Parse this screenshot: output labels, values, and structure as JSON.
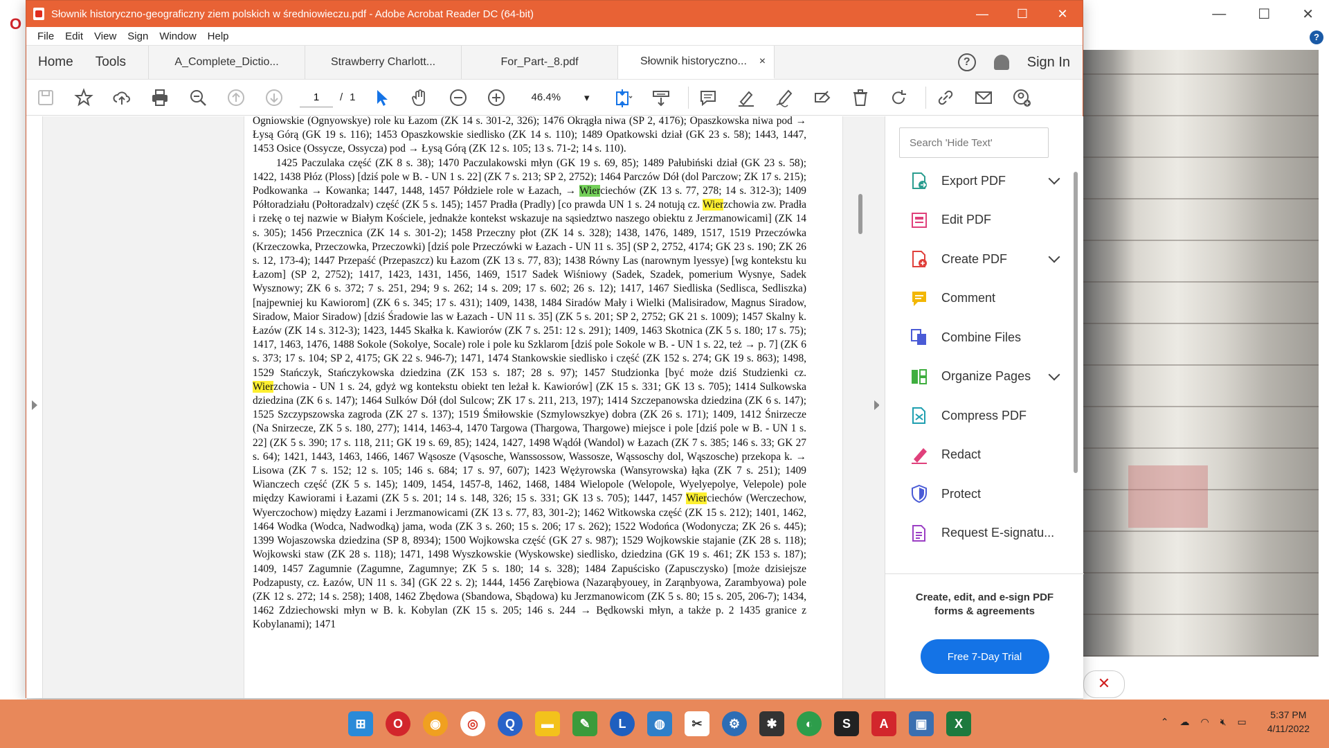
{
  "window": {
    "title": "Słownik historyczno-geograficzny ziem polskich w średniowieczu.pdf - Adobe Acrobat Reader DC (64-bit)",
    "minimize": "—",
    "maximize": "☐",
    "close": "✕"
  },
  "menu": [
    "File",
    "Edit",
    "View",
    "Sign",
    "Window",
    "Help"
  ],
  "tabs": {
    "home": "Home",
    "tools": "Tools",
    "docs": [
      {
        "label": "A_Complete_Dictio..."
      },
      {
        "label": "Strawberry Charlott..."
      },
      {
        "label": "For_Part-_8.pdf"
      },
      {
        "label": "Słownik historyczno..."
      }
    ],
    "close_tab": "×",
    "sign_in": "Sign In",
    "help_glyph": "?"
  },
  "toolbar": {
    "page_current": "1",
    "page_sep": "/",
    "page_total": "1",
    "zoom": "46.4%"
  },
  "document": {
    "p1": "Ogniowskie (Ognyowskye) role ku Łazom (ZK 14 s. 301-2, 326); 1476 Okrągła niwa (SP 2, 4176); Opaszkowska niwa pod → Łysą Górą (GK 19 s. 116); 1453 Opaszkowskie siedlisko (ZK 14 s. 110); 1489 Opatkowski dział (GK 23 s. 58); 1443, 1447, 1453 Osice (Ossycze, Ossycza) pod → Łysą Górą (ZK 12 s. 105; 13 s. 71-2; 14 s. 110).",
    "p2a": "1425 Paczulaka część (ZK 8 s. 38); 1470 Paczulakowski młyn (GK 19 s. 69, 85); 1489 Pałubiński dział (GK 23 s. 58); 1422, 1438 Płóz (Ploss) [dziś pole w B. - UN 1 s. 22] (ZK 7 s. 213; SP 2, 2752); 1464 Parczów Dół (dol Parczow; ZK 17 s. 215); Podkowanka → Kowanka; 1447, 1448, 1457 Półdziele role w Łazach, → ",
    "hl1": "Wier",
    "p2b": "ciechów (ZK 13 s. 77, 278; 14 s. 312-3); 1409 Półtoradziału (Połtoradzalv) część (ZK 5 s. 145); 1457 Pradła (Pradly) [co prawda UN 1 s. 24 notują cz. ",
    "hl2": "Wier",
    "p2c": "zchowia zw. Pradła i rzekę o tej nazwie w Białym Kościele, jednakże kontekst wskazuje na sąsiedztwo naszego obiektu z Jerzmanowicami] (ZK 14 s. 305); 1456 Przecznica (ZK 14 s. 301-2); 1458 Przeczny płot (ZK 14 s. 328); 1438, 1476, 1489, 1517, 1519 Przeczówka (Krzeczowka, Przeczowka, Przeczowki) [dziś pole Przeczówki w Łazach - UN 11 s. 35] (SP 2, 2752, 4174; GK 23 s. 190; ZK 26 s. 12, 173-4); 1447 Przepaść (Przepaszcz) ku Łazom (ZK 13 s. 77, 83); 1438 Równy Las (narownym lyessye) [wg kontekstu ku Łazom] (SP 2, 2752); 1417, 1423, 1431, 1456, 1469, 1517 Sadek Wiśniowy (Sadek, Szadek, pomerium Wysnye, Sadek Wysznowy; ZK 6 s. 372; 7 s. 251, 294; 9 s. 262; 14 s. 209; 17 s. 602; 26 s. 12); 1417, 1467 Siedliska (Sedlisca, Sedliszka) [najpewniej ku Kawiorom] (ZK 6 s. 345; 17 s. 431); 1409, 1438, 1484 Siradów Mały i Wielki (Malisiradow, Magnus Siradow, Siradow, Maior Siradow) [dziś Śradowie las w Łazach - UN 11 s. 35] (ZK 5 s. 201; SP 2, 2752; GK 21 s. 1009); 1457 Skalny k. Łazów (ZK 14 s. 312-3); 1423, 1445 Skałka k. Kawiorów (ZK 7 s. 251: 12 s. 291); 1409, 1463 Skotnica (ZK 5 s. 180; 17 s. 75); 1417, 1463, 1476, 1488 Sokole (Sokolye, Socale) role i pole ku Szklarom [dziś pole Sokole w B. - UN 1 s. 22, też → p. 7] (ZK 6 s. 373; 17 s. 104; SP 2, 4175; GK 22 s. 946-7); 1471, 1474 Stankowskie siedlisko i część (ZK 152 s. 274; GK 19 s. 863); 1498, 1529 Stańczyk, Stańczykowska dziedzina (ZK 153 s. 187; 28 s. 97); 1457 Studzionka [być może dziś Studzienki cz. ",
    "hl3": "Wier",
    "p2d": "zchowia - UN 1 s. 24, gdyż wg kontekstu obiekt ten leżał k. Kawiorów] (ZK 15 s. 331; GK 13 s. 705); 1414 Sulkowska dziedzina (ZK 6 s. 147); 1464 Sulków Dół (dol Sulcow; ZK 17 s. 211, 213, 197); 1414 Szczepanowska dziedzina (ZK 6 s. 147); 1525 Szczypszowska zagroda (ZK 27 s. 137); 1519 Śmiłowskie (Szmylowszkye) dobra (ZK 26 s. 171); 1409, 1412 Śnirzecze (Na Snirzecze, ZK 5 s. 180, 277); 1414, 1463-4, 1470 Targowa (Thargowa, Thargowe) miejsce i pole [dziś pole w B. - UN 1 s. 22] (ZK 5 s. 390; 17 s. 118, 211; GK 19 s. 69, 85); 1424, 1427, 1498 Wądół (Wandol) w Łazach (ZK 7 s. 385; 146 s. 33; GK 27 s. 64); 1421, 1443, 1463, 1466, 1467 Wąsosze (Vąsosche, Wanssossow, Wassosze, Wąssoschy dol, Wąszosche) przekopa k. → Lisowa (ZK 7 s. 152; 12 s. 105; 146 s. 684; 17 s. 97, 607); 1423 Wężyrowska (Wansyrowska) łąka (ZK 7 s. 251); 1409 Wianczech część (ZK 5 s. 145); 1409, 1454, 1457-8, 1462, 1468, 1484 Wielopole (Welopole, Wyelyepolye, Velepole) pole między Kawiorami i Łazami (ZK 5 s. 201; 14 s. 148, 326; 15 s. 331; GK 13 s. 705); 1447, 1457 ",
    "hl4": "Wier",
    "p2e": "ciechów (Werczechow, Wyerczochow) między Łazami i Jerzmanowicami (ZK 13 s. 77, 83, 301-2); 1462 Witkowska część (ZK 15 s. 212); 1401, 1462, 1464 Wodka (Wodca, Nadwodką) jama, woda (ZK 3 s. 260; 15 s. 206; 17 s. 262); 1522 Wodońca (Wodonycza; ZK 26 s. 445); 1399 Wojaszowska dziedzina (SP 8, 8934); 1500 Wojkowska część (GK 27 s. 987); 1529 Wojkowskie stajanie (ZK 28 s. 118); Wojkowski staw (ZK 28 s. 118); 1471, 1498 Wyszkowskie (Wyskowske) siedlisko, dziedzina (GK 19 s. 461; ZK 153 s. 187); 1409, 1457 Zagumnie (Zagumne, Zagumnye; ZK 5 s. 180; 14 s. 328); 1484 Zapuścisko (Zapusczysko) [może dzisiejsze Podzapusty, cz. Łazów, UN 11 s. 34] (GK 22 s. 2); 1444, 1456 Zarębiowa (Nazarąbyouey, in Zarąnbyowa, Zarambyowa) pole (ZK 12 s. 272; 14 s. 258); 1408, 1462 Zbędowa (Sbandowa, Sbądowa) ku Jerzmanowicom (ZK 5 s. 80; 15 s. 205, 206-7); 1434, 1462 Zdziechowski młyn w B. k. Kobylan (ZK 15 s. 205; 146 s. 244 → Będkowski młyn, a także p. 2 1435 granice z Kobylanami); 1471"
  },
  "right_pane": {
    "search_placeholder": "Search 'Hide Text'",
    "tools": [
      {
        "label": "Export PDF",
        "icon": "export-pdf-icon",
        "color": "#2a9d8f"
      },
      {
        "label": "Edit PDF",
        "icon": "edit-pdf-icon",
        "color": "#e0407b"
      },
      {
        "label": "Create PDF",
        "icon": "create-pdf-icon",
        "color": "#e0403b"
      },
      {
        "label": "Comment",
        "icon": "comment-icon",
        "color": "#f2b705"
      },
      {
        "label": "Combine Files",
        "icon": "combine-files-icon",
        "color": "#4a5bd6"
      },
      {
        "label": "Organize Pages",
        "icon": "organize-pages-icon",
        "color": "#3fae3f"
      },
      {
        "label": "Compress PDF",
        "icon": "compress-pdf-icon",
        "color": "#1e9fb0"
      },
      {
        "label": "Redact",
        "icon": "redact-icon",
        "color": "#e0407b"
      },
      {
        "label": "Protect",
        "icon": "protect-icon",
        "color": "#4a5bd6"
      },
      {
        "label": "Request E-signatu...",
        "icon": "request-esignature-icon",
        "color": "#9b3fc4"
      }
    ],
    "promo": "Create, edit, and e-sign PDF forms & agreements",
    "trial_button": "Free 7-Day Trial"
  },
  "background_window": {
    "minimize": "—",
    "maximize": "☐",
    "close": "✕",
    "help": "?",
    "cancel": "✕"
  },
  "taskbar": {
    "time": "5:37 PM",
    "date": "4/11/2022"
  },
  "colors": {
    "acrobat_orange": "#e86235",
    "taskbar": "#e8885a",
    "highlight_yellow": "#fef030",
    "highlight_green": "#74d05a",
    "trial_blue": "#1473e6"
  }
}
